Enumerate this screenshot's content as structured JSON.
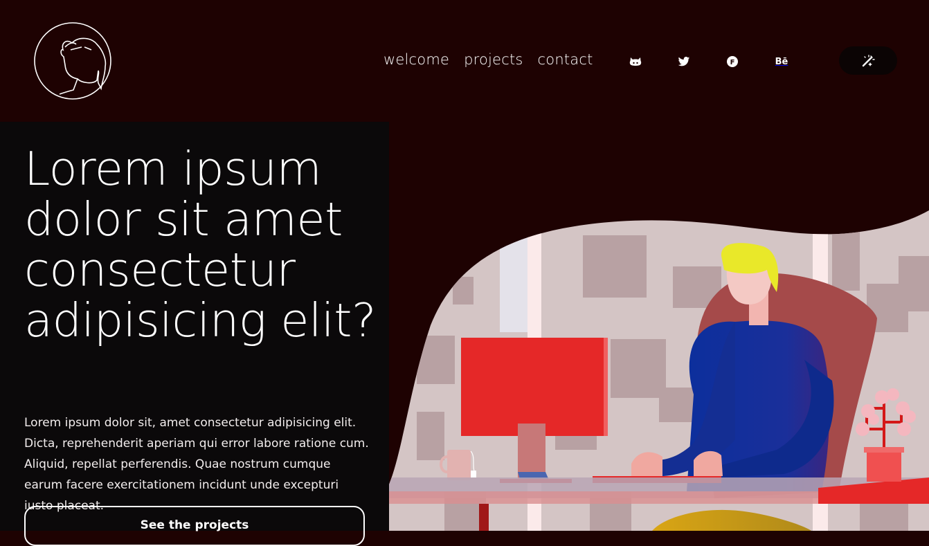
{
  "nav": {
    "items": [
      {
        "label": "welcome"
      },
      {
        "label": "projects"
      },
      {
        "label": "contact"
      }
    ]
  },
  "social": {
    "items": [
      {
        "icon": "github-icon"
      },
      {
        "icon": "twitter-icon"
      },
      {
        "icon": "facebook-icon",
        "glyph": "F"
      },
      {
        "icon": "behance-icon",
        "glyph": "Bē"
      }
    ]
  },
  "theme_toggle": {
    "icon": "magic-wand-icon"
  },
  "hero": {
    "title": "Lorem ipsum dolor sit amet consectetur adipisicing elit?",
    "text": "Lorem ipsum dolor sit, amet consectetur adipisicing elit. Dicta, reprehenderit aperiam qui error labore ratione cum. Aliquid, repellat perferendis. Quae nostrum cumque earum facere exercitationem incidunt unde excepturi iusto placeat.",
    "cta_label": "See the projects"
  },
  "colors": {
    "background": "#1e0202",
    "panel": "#0b090a",
    "toggle_bg": "#0b0404",
    "monitor": "#e52828",
    "shirt": "#0c2f9c",
    "hair": "#e9e829"
  }
}
